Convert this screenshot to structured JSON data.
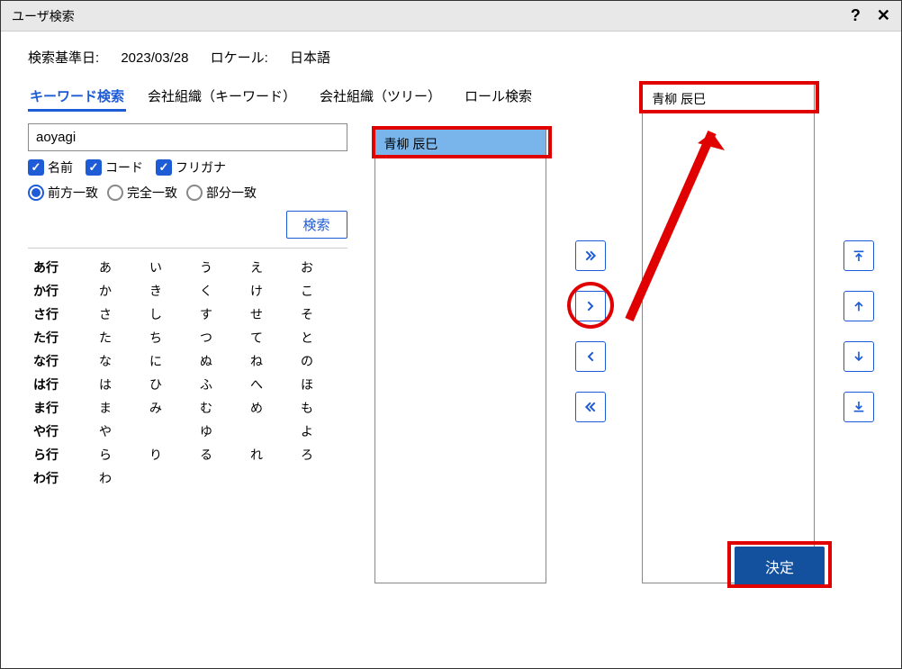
{
  "title": "ユーザ検索",
  "info": {
    "date_label": "検索基準日:",
    "date_value": "2023/03/28",
    "locale_label": "ロケール:",
    "locale_value": "日本語"
  },
  "tabs": {
    "keyword": "キーワード検索",
    "org_keyword": "会社組織（キーワード）",
    "org_tree": "会社組織（ツリー）",
    "role": "ロール検索"
  },
  "search": {
    "value": "aoyagi",
    "checks": {
      "name": "名前",
      "code": "コード",
      "kana": "フリガナ"
    },
    "radios": {
      "prefix": "前方一致",
      "exact": "完全一致",
      "partial": "部分一致"
    },
    "button": "検索"
  },
  "kana": {
    "rows": [
      {
        "head": "あ行",
        "cells": [
          "あ",
          "い",
          "う",
          "え",
          "お"
        ]
      },
      {
        "head": "か行",
        "cells": [
          "か",
          "き",
          "く",
          "け",
          "こ"
        ]
      },
      {
        "head": "さ行",
        "cells": [
          "さ",
          "し",
          "す",
          "せ",
          "そ"
        ]
      },
      {
        "head": "た行",
        "cells": [
          "た",
          "ち",
          "つ",
          "て",
          "と"
        ]
      },
      {
        "head": "な行",
        "cells": [
          "な",
          "に",
          "ぬ",
          "ね",
          "の"
        ]
      },
      {
        "head": "は行",
        "cells": [
          "は",
          "ひ",
          "ふ",
          "へ",
          "ほ"
        ]
      },
      {
        "head": "ま行",
        "cells": [
          "ま",
          "み",
          "む",
          "め",
          "も"
        ]
      },
      {
        "head": "や行",
        "cells": [
          "や",
          "",
          "ゆ",
          "",
          "よ"
        ]
      },
      {
        "head": "ら行",
        "cells": [
          "ら",
          "り",
          "る",
          "れ",
          "ろ"
        ]
      },
      {
        "head": "わ行",
        "cells": [
          "わ",
          "",
          "",
          "",
          ""
        ]
      }
    ]
  },
  "results": {
    "item1": "青柳 辰巳"
  },
  "selected": {
    "item1": "青柳 辰巳"
  },
  "footer": {
    "decide": "決定"
  }
}
